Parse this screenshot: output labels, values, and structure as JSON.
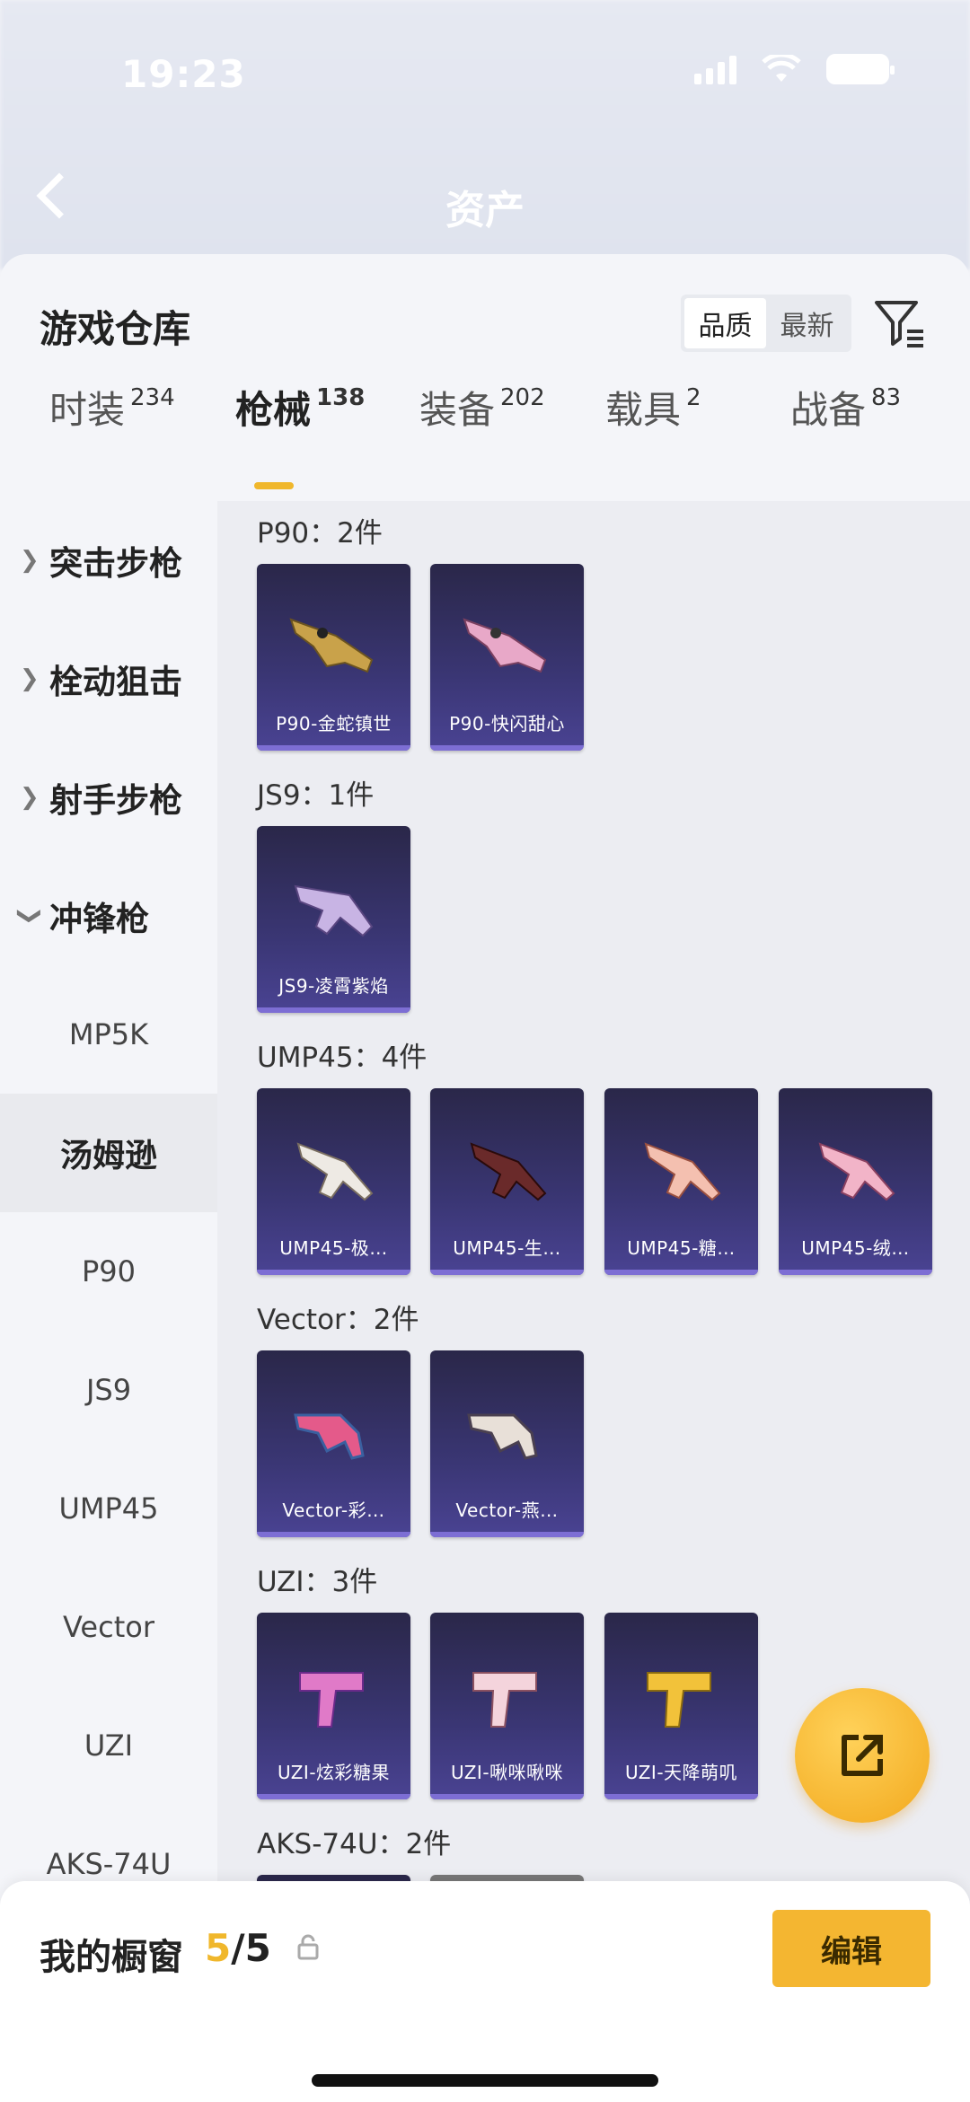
{
  "status_bar": {
    "time": "19:23"
  },
  "background_nav": {
    "title": "资产"
  },
  "sheet": {
    "title": "游戏仓库"
  },
  "sort": {
    "options": [
      "品质",
      "最新"
    ],
    "active": "品质"
  },
  "tabs": [
    {
      "label": "时装",
      "count": "234"
    },
    {
      "label": "枪械",
      "count": "138",
      "active": true
    },
    {
      "label": "装备",
      "count": "202"
    },
    {
      "label": "载具",
      "count": "2"
    },
    {
      "label": "战备",
      "count": "83"
    }
  ],
  "sidebar": {
    "groups": [
      "突击步枪",
      "栓动狙击",
      "射手步枪",
      "冲锋枪"
    ],
    "subitems": [
      "MP5K",
      "汤姆逊",
      "P90",
      "JS9",
      "UMP45",
      "Vector",
      "UZI",
      "AKS-74U"
    ],
    "active_sub": "汤姆逊"
  },
  "content": {
    "groups": [
      {
        "label": "P90：2件",
        "items": [
          "P90-金蛇镇世",
          "P90-快闪甜心"
        ]
      },
      {
        "label": "JS9：1件",
        "items": [
          "JS9-凌霄紫焰"
        ]
      },
      {
        "label": "UMP45：4件",
        "items": [
          "UMP45-极…",
          "UMP45-生…",
          "UMP45-糖…",
          "UMP45-绒…"
        ]
      },
      {
        "label": "Vector：2件",
        "items": [
          "Vector-彩…",
          "Vector-燕…"
        ]
      },
      {
        "label": "UZI：3件",
        "items": [
          "UZI-炫彩糖果",
          "UZI-啾咪啾咪",
          "UZI-天降萌叽"
        ]
      },
      {
        "label": "AKS-74U：2件",
        "items": []
      }
    ]
  },
  "bottom_bar": {
    "label": "我的橱窗",
    "count_current": "5",
    "count_sep_total": "/5",
    "edit_label": "编辑"
  },
  "colors": {
    "accent": "#f0b72c",
    "card_bg": "#3a3674"
  }
}
